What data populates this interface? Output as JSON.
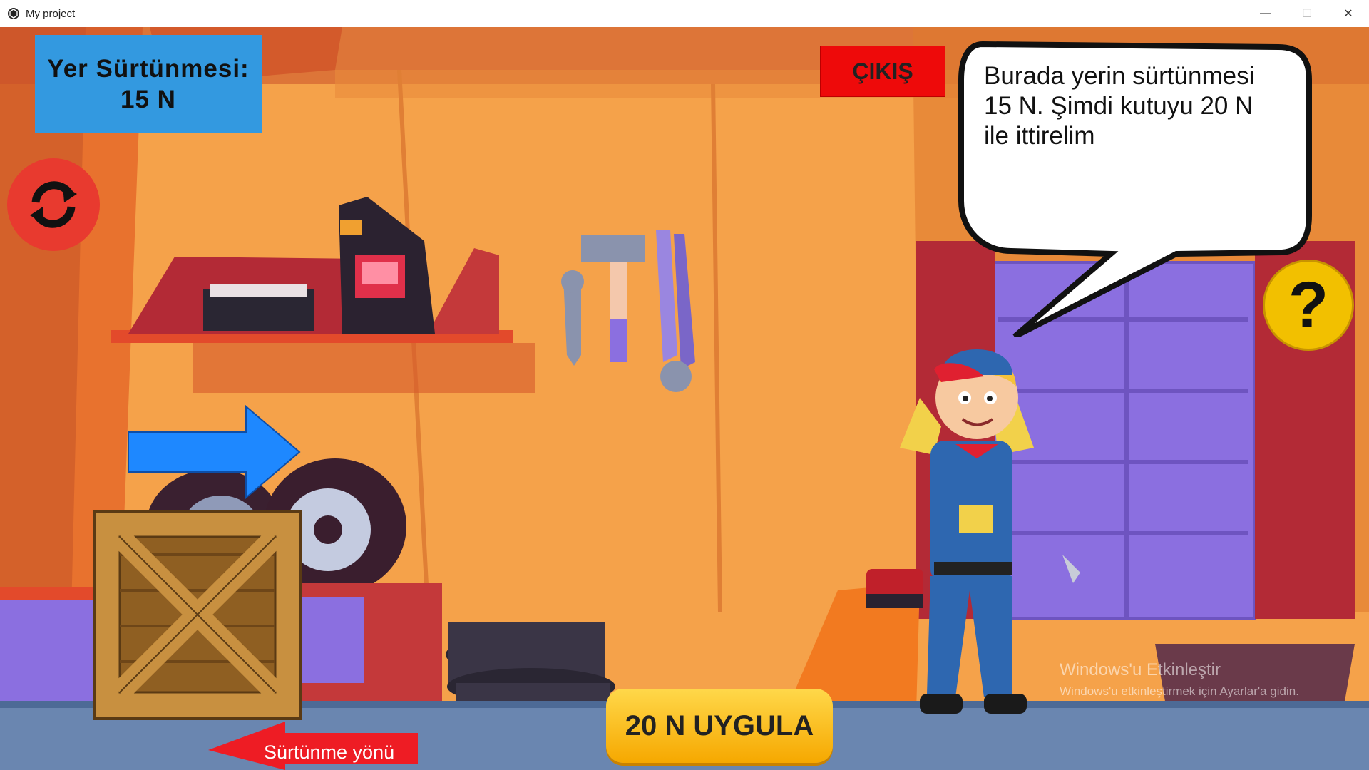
{
  "window": {
    "title": "My project",
    "minimize_glyph": "—",
    "maximize_glyph": "☐",
    "close_glyph": "✕"
  },
  "hud": {
    "friction_title": "Yer Sürtünmesi:",
    "friction_value": "15 N",
    "exit_label": "ÇIKIŞ",
    "help_glyph": "?",
    "reset_icon": "refresh-icon"
  },
  "dialog": {
    "text": " Burada yerin sürtünmesi\n15 N. Şimdi kutuyu 20 N\nile ittirelim"
  },
  "controls": {
    "apply_label": "20 N UYGULA",
    "friction_direction_label": "Sürtünme yönü"
  },
  "watermark": {
    "title": "Windows'u Etkinleştir",
    "subtitle": "Windows'u etkinleştirmek için Ayarlar'a gidin."
  },
  "colors": {
    "panel_blue": "#3399e0",
    "exit_red": "#ee0a0a",
    "reset_red": "#e83a2f",
    "help_yellow": "#f2c000",
    "apply_gold": "#f6b800",
    "arrow_blue": "#1e88ff",
    "arrow_red": "#ee1c24",
    "wall_orange": "#f5a24a",
    "crate_brown": "#c89040"
  }
}
